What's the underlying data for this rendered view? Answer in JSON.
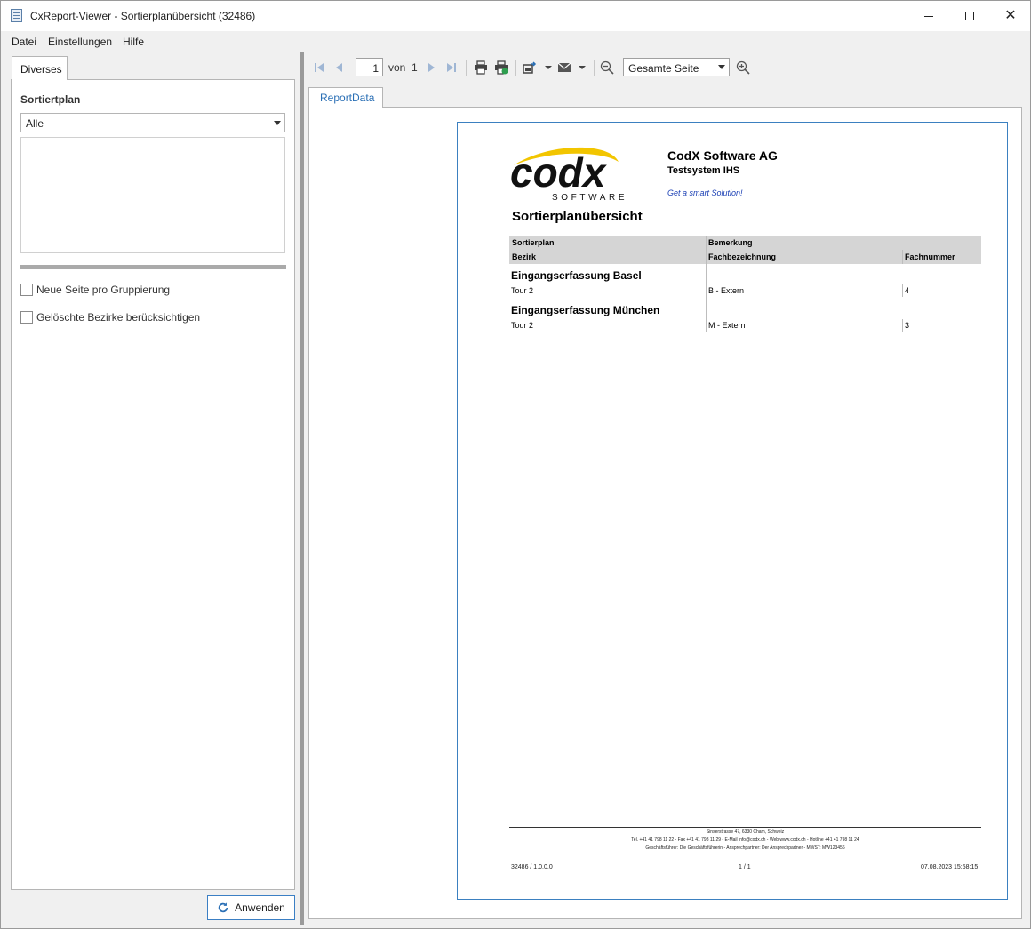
{
  "window": {
    "title": "CxReport-Viewer - Sortierplanübersicht (32486)",
    "close_glyph": "✕"
  },
  "menu": [
    "Datei",
    "Einstellungen",
    "Hilfe"
  ],
  "left_panel": {
    "tab_label": "Diverses",
    "section_title": "Sortiertplan",
    "combo_value": "Alle",
    "checkboxes": [
      {
        "label": "Neue Seite pro Gruppierung",
        "checked": false
      },
      {
        "label": "Gelöschte Bezirke berücksichtigen",
        "checked": false
      }
    ],
    "apply_label": "Anwenden"
  },
  "toolbar": {
    "page_value": "1",
    "of_label": "von",
    "total_pages": "1",
    "zoom_value": "Gesamte Seite"
  },
  "report_tab": "ReportData",
  "report": {
    "company": "CodX Software AG",
    "subtitle": "Testsystem IHS",
    "slogan": "Get a smart Solution!",
    "logo_text": "codx",
    "logo_sub": "SOFTWARE",
    "title": "Sortierplanübersicht",
    "headers": {
      "sortierplan": "Sortierplan",
      "bemerkung": "Bemerkung",
      "bezirk": "Bezirk",
      "fachbezeichnung": "Fachbezeichnung",
      "fachnummer": "Fachnummer"
    },
    "groups": [
      {
        "title": "Eingangserfassung Basel",
        "bezirk": "Tour 2",
        "fach": "B - Extern",
        "nummer": "4"
      },
      {
        "title": "Eingangserfassung München",
        "bezirk": "Tour 2",
        "fach": "M - Extern",
        "nummer": "3"
      }
    ],
    "footer": {
      "line1": "Sinserstrasse 47, 6330 Cham, Schweiz",
      "line2": "Tel. +41 41 798 11 22 - Fax +41 41 798 11 29 - E-Mail info@codx.ch - Web www.codx.ch - Hotline +41 41 798 11 24",
      "line3": "Geschäftsführer: Die Geschäftsführerin - Ansprechpartner: Der Ansprechpartner - MWST: MW123456",
      "left": "32486 / 1.0.0.0",
      "center": "1 / 1",
      "right": "07.08.2023 15:58:15"
    }
  },
  "colors": {
    "accent": "#3b7fc4",
    "logo_swoosh": "#f2c500",
    "slogan": "#1a3fb4"
  }
}
